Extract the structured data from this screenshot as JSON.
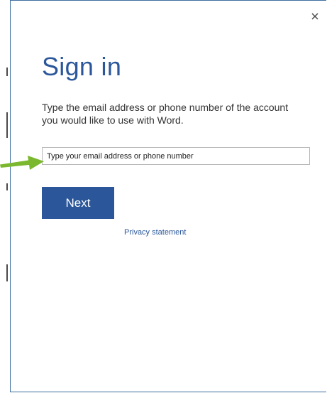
{
  "dialog": {
    "title": "Sign in",
    "description": "Type the email address or phone number of the account you would like to use with Word.",
    "close_icon": "close-icon",
    "email_input": {
      "value": "",
      "placeholder": "Type your email address or phone number"
    },
    "next_label": "Next",
    "privacy_label": "Privacy statement"
  },
  "annotation": {
    "arrow_icon": "arrow-right-icon",
    "arrow_color": "#7cb82f"
  },
  "colors": {
    "accent": "#2b579a",
    "border": "#3f6f9f",
    "text": "#333333"
  }
}
